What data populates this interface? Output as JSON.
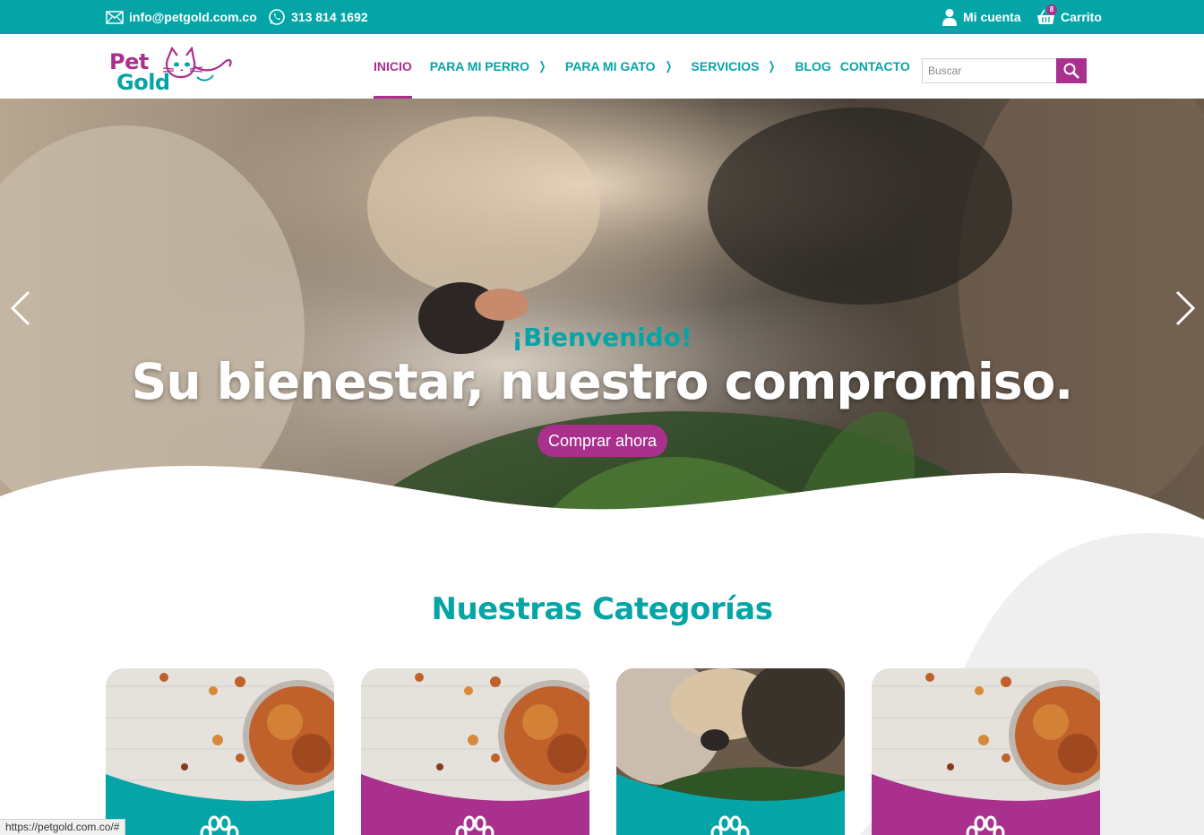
{
  "topbar": {
    "email": "info@petgold.com.co",
    "phone": "313 814 1692",
    "account_label": "Mi cuenta",
    "cart_label": "Carrito",
    "cart_count": "8"
  },
  "header": {
    "logo_line1": "Pet",
    "logo_line2": "Gold",
    "nav": [
      {
        "label": "INICIO",
        "active": true
      },
      {
        "label": "PARA MI PERRO",
        "has_submenu": true
      },
      {
        "label": "PARA MI GATO",
        "has_submenu": true
      },
      {
        "label": "SERVICIOS",
        "has_submenu": true
      },
      {
        "label": "BLOG"
      },
      {
        "label": "CONTACTO"
      }
    ],
    "search": {
      "placeholder": "Buscar"
    }
  },
  "hero": {
    "welcome": "¡Bienvenido!",
    "title": "Su bienestar, nuestro compromiso.",
    "cta_label": "Comprar ahora"
  },
  "categories": {
    "title": "Nuestras Categorías",
    "cards": [
      {
        "image": "dog-food-bowl",
        "band_color": "#05a5a7",
        "icon": "paw-icon"
      },
      {
        "image": "dog-food-bowl",
        "band_color": "#a9308c",
        "icon": "paw-icon"
      },
      {
        "image": "cat-and-dog-on-grass",
        "band_color": "#05a5a7",
        "icon": "paw-icon"
      },
      {
        "image": "dog-food-bowl",
        "band_color": "#a9308c",
        "icon": "paw-icon"
      }
    ]
  },
  "status_bar": {
    "url": "https://petgold.com.co/#"
  },
  "colors": {
    "teal": "#05a5a7",
    "magenta": "#a9308c"
  }
}
